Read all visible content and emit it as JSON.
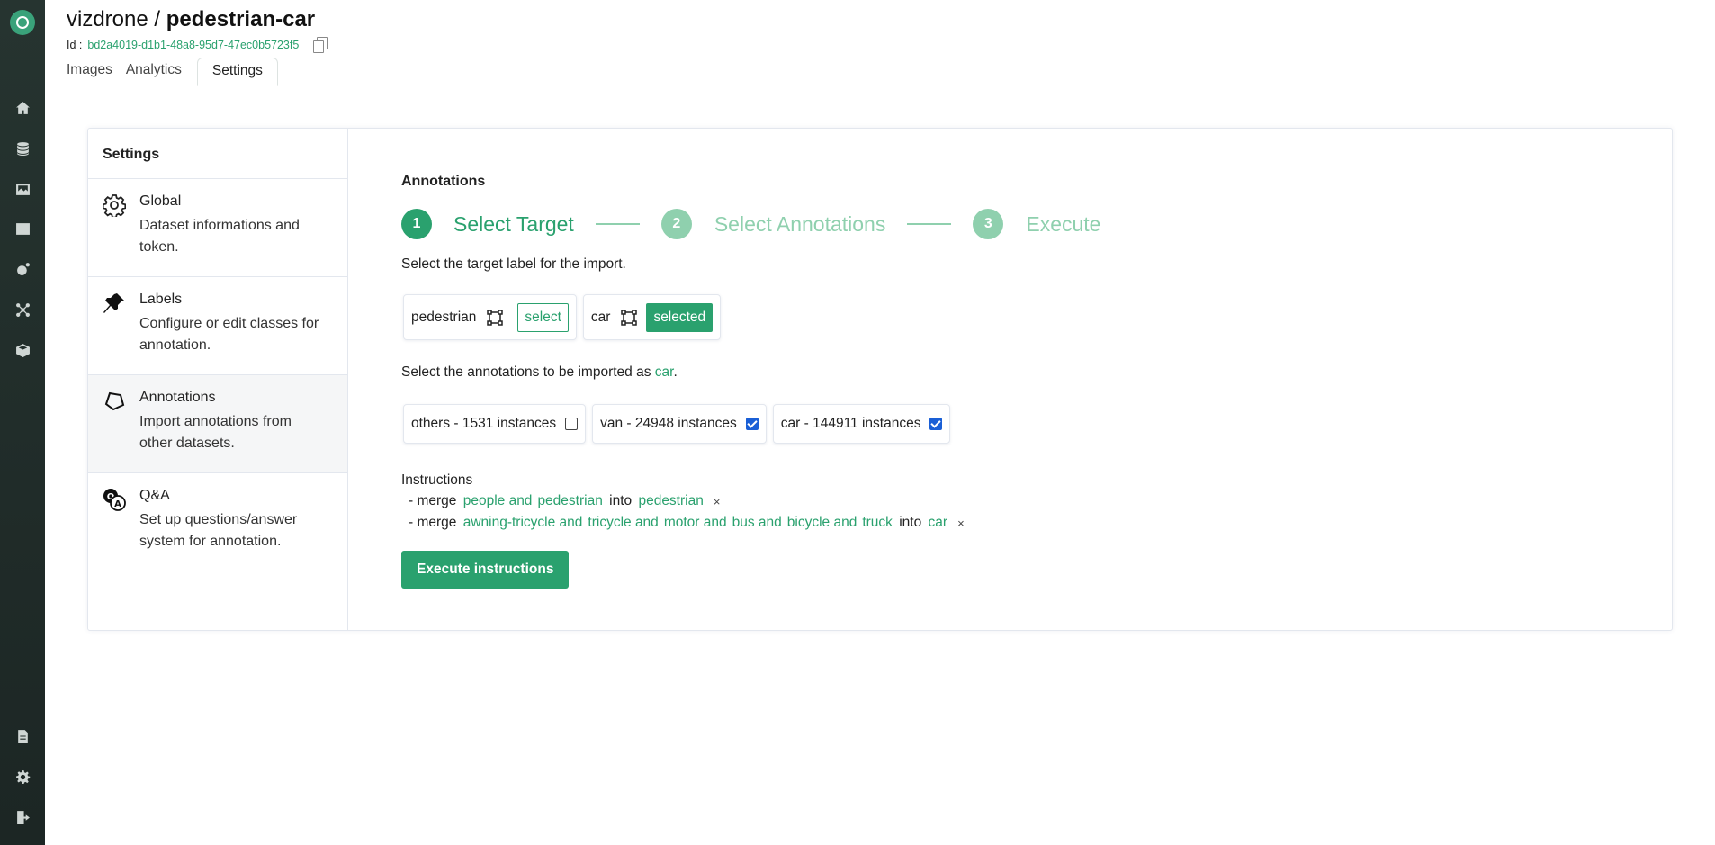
{
  "header": {
    "project": "vizdrone",
    "separator": "/",
    "dataset": "pedestrian-car",
    "id_label": "Id :",
    "id_value": "bd2a4019-d1b1-48a8-95d7-47ec0b5723f5",
    "tabs": [
      {
        "label": "Images"
      },
      {
        "label": "Analytics"
      },
      {
        "label": "Settings"
      }
    ],
    "active_tab": "Settings"
  },
  "rail": {
    "top_icons": [
      "home-icon",
      "database-icon",
      "image-icon",
      "chart-icon",
      "robot-icon",
      "network-icon",
      "cube-icon"
    ],
    "bottom_icons": [
      "document-icon",
      "gear-icon",
      "logout-icon"
    ]
  },
  "settings": {
    "heading": "Settings",
    "items": [
      {
        "title": "Global",
        "desc": "Dataset informations and token.",
        "icon": "gear-icon"
      },
      {
        "title": "Labels",
        "desc": "Configure or edit classes for annotation.",
        "icon": "pin-icon"
      },
      {
        "title": "Annotations",
        "desc": "Import annotations from other datasets.",
        "icon": "polygon-icon"
      },
      {
        "title": "Q&A",
        "desc": "Set up questions/answer system for annotation.",
        "icon": "qa-icon"
      }
    ],
    "active_item": "Annotations"
  },
  "annotations": {
    "title": "Annotations",
    "steps": [
      {
        "num": "1",
        "label": "Select Target"
      },
      {
        "num": "2",
        "label": "Select Annotations"
      },
      {
        "num": "3",
        "label": "Execute"
      }
    ],
    "active_step": 1,
    "target_prompt": "Select the target label for the import.",
    "targets": [
      {
        "label": "pedestrian",
        "button": "select"
      },
      {
        "label": "car",
        "button": "selected"
      }
    ],
    "import_prompt_prefix": "Select the annotations to be imported as",
    "import_prompt_target": "car",
    "import_prompt_suffix": ".",
    "sources": [
      {
        "label": "others - 1531 instances",
        "checked": false
      },
      {
        "label": "van - 24948 instances",
        "checked": true
      },
      {
        "label": "car - 144911 instances",
        "checked": true
      }
    ],
    "instructions_title": "Instructions",
    "instructions": [
      {
        "prefix": "- merge",
        "items": [
          "people and",
          "pedestrian"
        ],
        "into": "into",
        "target": "pedestrian",
        "remove": "×"
      },
      {
        "prefix": "- merge",
        "items": [
          "awning-tricycle and",
          "tricycle and",
          "motor and",
          "bus and",
          "bicycle and",
          "truck"
        ],
        "into": "into",
        "target": "car",
        "remove": "×"
      }
    ],
    "execute_label": "Execute instructions"
  },
  "colors": {
    "accent": "#2aa16e",
    "accent_light": "#8fd0ae",
    "rail_bg": "#263430",
    "checkbox": "#1a5fd6"
  }
}
